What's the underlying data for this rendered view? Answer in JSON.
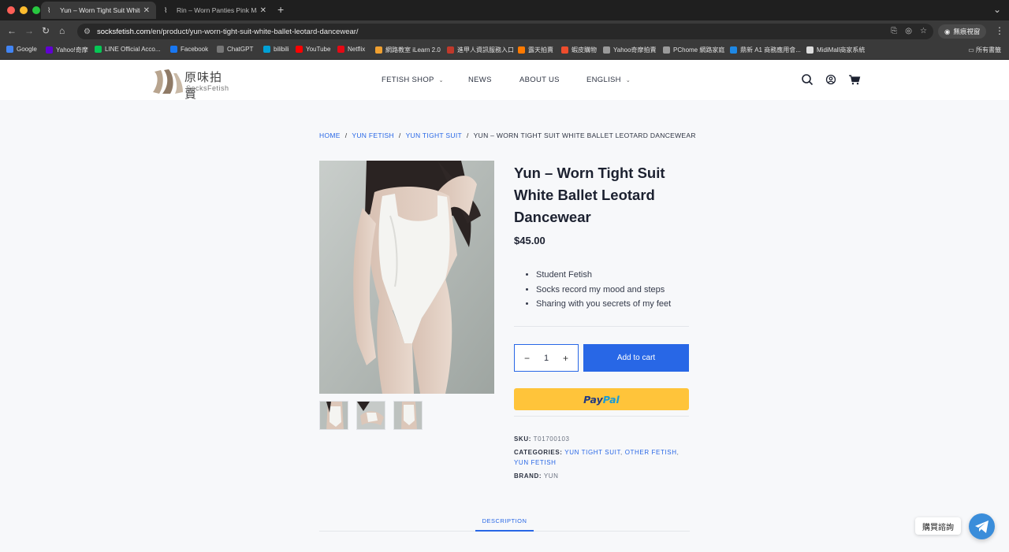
{
  "browser": {
    "tabs": [
      {
        "title": "Yun – Worn Tight Suit White B",
        "active": true
      },
      {
        "title": "Rin – Worn Panties Pink Maid",
        "active": false
      }
    ],
    "url_domain": "socksfetish.com",
    "url_path": "/en/product/yun-worn-tight-suit-white-ballet-leotard-dancewear/",
    "incognito_label": "無痕視窗",
    "bookmarks": [
      {
        "label": "Google",
        "icon": "google-icon",
        "color": "#4285f4"
      },
      {
        "label": "Yahoo!奇摩",
        "icon": "yahoo-icon",
        "color": "#6001d2"
      },
      {
        "label": "LINE Official Acco...",
        "icon": "line-icon",
        "color": "#06c755"
      },
      {
        "label": "Facebook",
        "icon": "facebook-icon",
        "color": "#1877f2"
      },
      {
        "label": "ChatGPT",
        "icon": "chatgpt-icon",
        "color": "#777777"
      },
      {
        "label": "bilibili",
        "icon": "bilibili-icon",
        "color": "#00a1d6"
      },
      {
        "label": "YouTube",
        "icon": "youtube-icon",
        "color": "#ff0000"
      },
      {
        "label": "Netflix",
        "icon": "netflix-icon",
        "color": "#e50914"
      },
      {
        "label": "網路教室 iLearn 2.0",
        "icon": "ilearn-icon",
        "color": "#f0a030"
      },
      {
        "label": "進甲人資訊服務入口",
        "icon": "portal-icon",
        "color": "#c0392b"
      },
      {
        "label": "露天拍賣",
        "icon": "ruten-icon",
        "color": "#ff7a00"
      },
      {
        "label": "蝦皮購物",
        "icon": "shopee-icon",
        "color": "#ee4d2d"
      },
      {
        "label": "Yahoo奇摩拍賣",
        "icon": "yahoo-auction-icon",
        "color": "#9a9a9a"
      },
      {
        "label": "PChome 網路家庭",
        "icon": "pchome-icon",
        "color": "#9a9a9a"
      },
      {
        "label": "鼎新 A1 商務應用會...",
        "icon": "dsc-icon",
        "color": "#1e88e5"
      },
      {
        "label": "MidiMall商家系統",
        "icon": "midimall-icon",
        "color": "#dddddd"
      }
    ],
    "all_bookmarks_label": "所有書籤"
  },
  "site": {
    "logo_cn": "原味拍賣",
    "logo_en": "SocksFetish",
    "menu": [
      {
        "label": "FETISH SHOP",
        "dropdown": true
      },
      {
        "label": "NEWS",
        "dropdown": false
      },
      {
        "label": "ABOUT US",
        "dropdown": false
      },
      {
        "label": "ENGLISH",
        "dropdown": true
      }
    ]
  },
  "breadcrumb": [
    {
      "label": "HOME",
      "link": true
    },
    {
      "label": "YUN FETISH",
      "link": true
    },
    {
      "label": "YUN TIGHT SUIT",
      "link": true
    },
    {
      "label": "YUN – WORN TIGHT SUIT WHITE BALLET LEOTARD DANCEWEAR",
      "link": false
    }
  ],
  "product": {
    "title": "Yun – Worn Tight Suit White Ballet Leotard Dancewear",
    "price": "$45.00",
    "bullets": [
      "Student Fetish",
      "Socks record my mood and steps",
      "Sharing with you secrets of my feet"
    ],
    "quantity": "1",
    "add_to_cart": "Add to cart",
    "paypal_p1": "Pay",
    "paypal_p2": "Pal",
    "sku_label": "SKU:",
    "sku": "T01700103",
    "categories_label": "CATEGORIES:",
    "categories": [
      "YUN TIGHT SUIT",
      "OTHER FETISH",
      "YUN FETISH"
    ],
    "brand_label": "BRAND:",
    "brand": "YUN",
    "tab_description": "DESCRIPTION"
  },
  "chat": {
    "label": "購買諮詢"
  },
  "colors": {
    "accent": "#2867e6",
    "paypal_yellow": "#ffc43a",
    "telegram_blue": "#3a8dda"
  }
}
